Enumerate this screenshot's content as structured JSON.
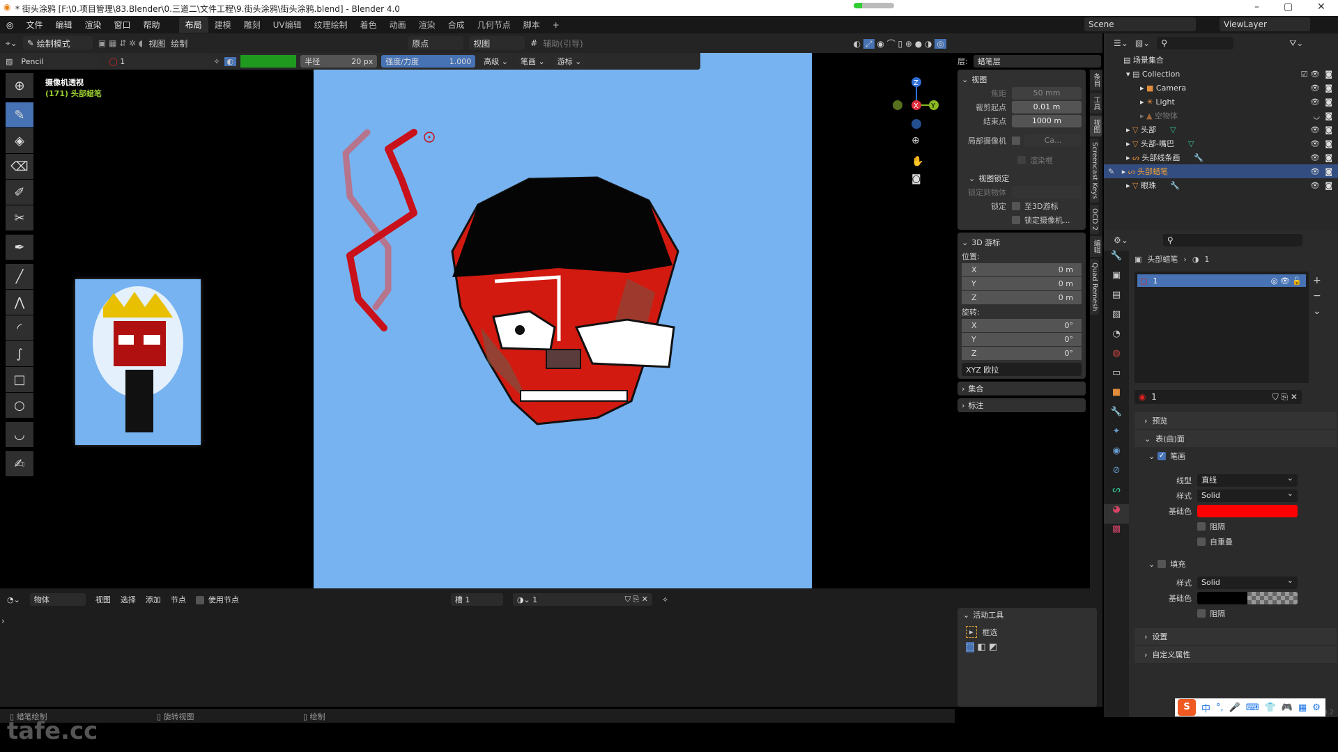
{
  "titlebar": {
    "title": "* 街头涂鸦 [F:\\0.项目管理\\83.Blender\\0.三道二\\文件工程\\9.街头涂鸦\\街头涂鸦.blend] - Blender 4.0",
    "progress": 0.2,
    "minimize": "–",
    "maximize": "▢",
    "close": "✕"
  },
  "menu": {
    "items": [
      "文件",
      "编辑",
      "渲染",
      "窗口",
      "帮助"
    ],
    "workspaces": [
      "布局",
      "建模",
      "雕刻",
      "UV编辑",
      "纹理绘制",
      "着色",
      "动画",
      "渲染",
      "合成",
      "几何节点",
      "脚本"
    ],
    "active_workspace": "布局",
    "add": "+",
    "scene": "Scene",
    "view_layer": "ViewLayer"
  },
  "header": {
    "mode": "绘制模式",
    "view": "视图",
    "draw": "绘制",
    "pivot": "原点",
    "orientation": "视图",
    "guides": "辅助(引导)"
  },
  "toolsettings": {
    "brush": "Pencil",
    "material": "1",
    "radius_label": "半径",
    "radius": "20 px",
    "strength_label": "强度/力度",
    "strength": "1.000",
    "advanced": "高级",
    "stroke": "笔画",
    "cursor": "游标",
    "color_swatch": "#1f9a1f"
  },
  "viewport": {
    "view_name": "摄像机透视",
    "object_info": "(171) 头部蜡笔",
    "layer_label": "层:",
    "layer": "蜡笔层",
    "canvas_color": "#77b3f1"
  },
  "npanel": {
    "view": {
      "title": "视图",
      "focal_label": "焦距",
      "focal": "50 mm",
      "clip_start_label": "裁剪起点",
      "clip_start": "0.01 m",
      "clip_end_label": "结束点",
      "clip_end": "1000 m",
      "local_camera_label": "局部摄像机",
      "local_camera": "Ca...",
      "render_region": "渲染框"
    },
    "view_lock": {
      "title": "视图锁定",
      "lock_object_label": "锁定到物体",
      "lock_label": "锁定",
      "to_cursor": "至3D游标",
      "lock_camera": "锁定摄像机..."
    },
    "cursor": {
      "title": "3D 游标",
      "location_label": "位置:",
      "loc": [
        {
          "axis": "X",
          "value": "0 m"
        },
        {
          "axis": "Y",
          "value": "0 m"
        },
        {
          "axis": "Z",
          "value": "0 m"
        }
      ],
      "rotation_label": "旋转:",
      "rot": [
        {
          "axis": "X",
          "value": "0°"
        },
        {
          "axis": "Y",
          "value": "0°"
        },
        {
          "axis": "Z",
          "value": "0°"
        }
      ],
      "mode": "XYZ 欧拉"
    },
    "collections": "集合",
    "annotations": "标注",
    "tabs": [
      "条目",
      "工具",
      "视图",
      "Screencast Keys",
      "OCD 2",
      "编辑",
      "Quad Remesh"
    ]
  },
  "outliner": {
    "root": "场景集合",
    "items": [
      {
        "name": "Collection",
        "indent": 1
      },
      {
        "name": "Camera",
        "indent": 2
      },
      {
        "name": "Light",
        "indent": 2
      },
      {
        "name": "空物体",
        "indent": 2
      },
      {
        "name": "头部",
        "indent": 1
      },
      {
        "name": "头部-嘴巴",
        "indent": 1
      },
      {
        "name": "头部线条画",
        "indent": 1
      },
      {
        "name": "头部蜡笔",
        "indent": 1,
        "selected": true
      },
      {
        "name": "眼珠",
        "indent": 1
      }
    ]
  },
  "properties": {
    "breadcrumb_object": "头部蜡笔",
    "breadcrumb_material": "1",
    "slot": "1",
    "material_name": "1",
    "preview": "预览",
    "surface": "表(曲)面",
    "stroke": "笔画",
    "line_type_label": "线型",
    "line_type": "直线",
    "style_label": "样式",
    "stroke_style": "Solid",
    "base_color_label": "基础色",
    "stroke_color": "#ff0000",
    "holdout": "阻隔",
    "self_overlap": "自重叠",
    "fill": "填充",
    "fill_style": "Solid",
    "fill_color": "#000000",
    "settings": "设置",
    "custom_props": "自定义属性",
    "version": "4.0.2"
  },
  "bottom": {
    "editor": "物体",
    "view": "视图",
    "select": "选择",
    "add": "添加",
    "node": "节点",
    "use_nodes": "使用节点",
    "slot": "槽 1",
    "material": "1"
  },
  "active_tool": {
    "title": "活动工具",
    "tool": "框选"
  },
  "status": {
    "left": "蜡笔绘制",
    "middle": "旋转视图",
    "right": "绘制"
  },
  "watermark": "tafe.cc",
  "ime": {
    "lang": "中",
    "punct": "°,"
  }
}
